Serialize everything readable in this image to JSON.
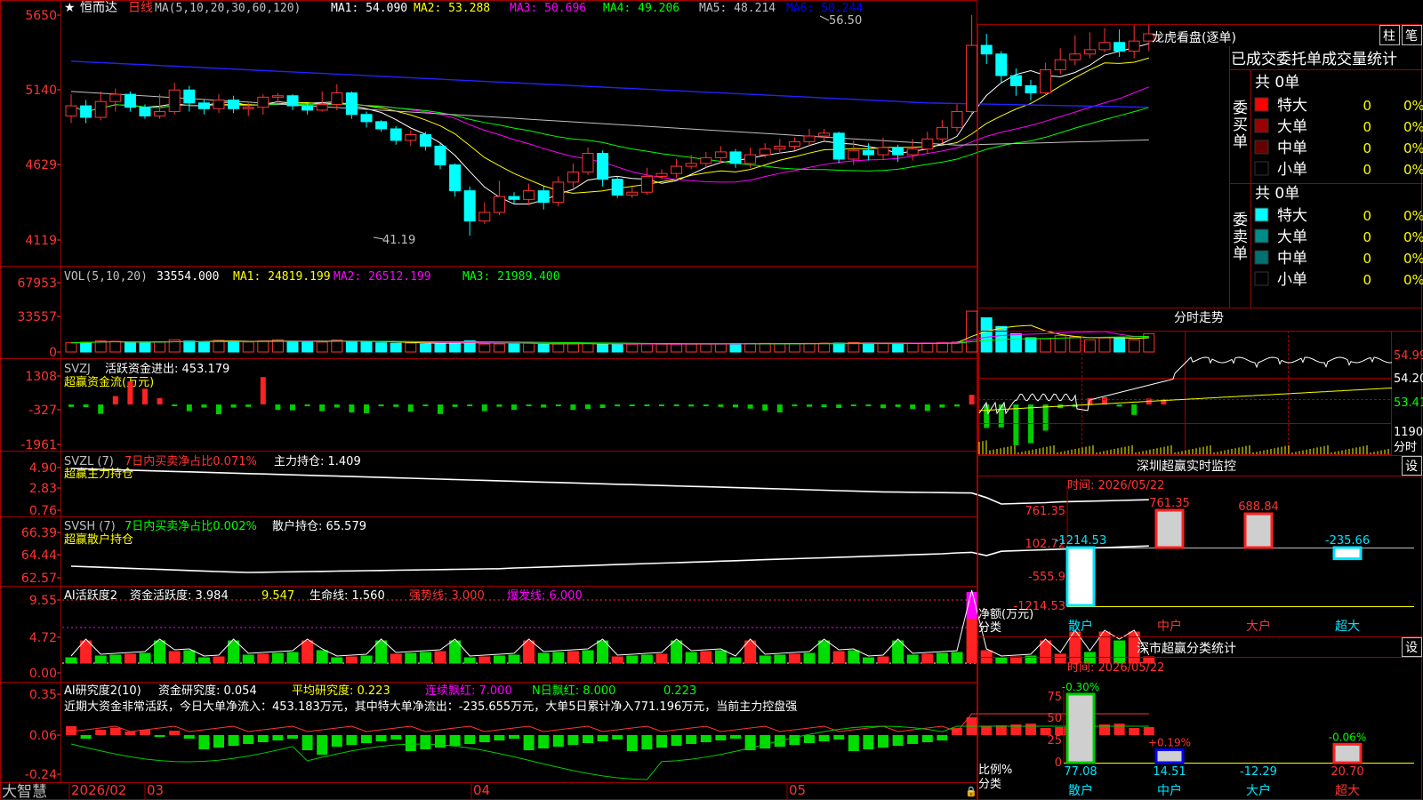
{
  "header": {
    "stock_name": "恒而达",
    "period": "日线",
    "ma_label": "MA(5,10,20,30,60,120)",
    "ma_values": [
      {
        "text": "MA1: 54.090",
        "color": "#ffffff"
      },
      {
        "text": "MA2: 53.288",
        "color": "#ffff00"
      },
      {
        "text": "MA3: 50.696",
        "color": "#ff00ff"
      },
      {
        "text": "MA4: 49.206",
        "color": "#00ff00"
      },
      {
        "text": "MA5: 48.214",
        "color": "#c0c0c0"
      },
      {
        "text": "MA6: 50.244",
        "color": "#0000ff"
      }
    ],
    "price_ticks": [
      "5650",
      "5140",
      "4629",
      "4119"
    ],
    "high_mark": "56.50",
    "low_mark": "41.19"
  },
  "volume": {
    "title": "VOL(5,10,20)",
    "value": "33554.000",
    "ma": [
      {
        "text": "MA1: 24819.199",
        "color": "#ffff00"
      },
      {
        "text": "MA2: 26512.199",
        "color": "#ff00ff"
      },
      {
        "text": "MA3: 21989.400",
        "color": "#00ff00"
      }
    ],
    "ticks": [
      "67953",
      "33557",
      "0"
    ]
  },
  "svzj": {
    "title": "SVZJ",
    "metric": "活跃资金进出: 453.179",
    "subtitle": "超赢资金流(万元)",
    "ticks": [
      "1308",
      "-327",
      "-1961"
    ]
  },
  "svzl": {
    "title": "SVZL (7)",
    "metric1": "7日内买卖净占比0.071%",
    "metric2": "主力持仓: 1.409",
    "subtitle": "超赢主力持仓",
    "ticks": [
      "4.90",
      "2.83",
      "0.76"
    ]
  },
  "svsh": {
    "title": "SVSH (7)",
    "metric1": "7日内买卖净占比0.002%",
    "metric2": "散户持仓: 65.579",
    "subtitle": "超赢散户持仓",
    "ticks": [
      "66.39",
      "64.44",
      "62.57"
    ]
  },
  "ai1": {
    "title": "AI活跃度2",
    "metric1": "资金活跃度: 3.984",
    "metric2": "9.547",
    "metric3": "生命线: 1.560",
    "metric4": "强势线: 3.000",
    "metric5": "爆发线: 6.000",
    "ticks": [
      "9.55",
      "4.72",
      "0.00"
    ]
  },
  "ai2": {
    "title": "AI研究度2(10)",
    "metric1": "资金研究度: 0.054",
    "metric2": "平均研究度: 0.223",
    "metric3": "连续飘红: 7.000",
    "metric4": "N日飘红: 8.000",
    "metric5": "0.223",
    "description": "近期大资金非常活跃，今日大单净流入：453.183万元，其中特大单净流出：-235.655万元，大单5日累计净入771.196万元，当前主力控盘强",
    "ticks": [
      "0.35",
      "0.06",
      "-0.24"
    ]
  },
  "xaxis": {
    "brand": "大智慧",
    "labels": [
      "2026/02",
      "03",
      "04",
      "05"
    ]
  },
  "dragon": {
    "title": "龙虎看盘(逐单)",
    "tab1": "柱",
    "tab2": "笔",
    "subtitle": "已成交委托单成交量统计",
    "buy_label": "委买单",
    "sell_label": "委卖单",
    "buy_total": "共 0单",
    "sell_total": "共 0单",
    "buy_rows": [
      {
        "name": "特大",
        "count": "0",
        "pct": "0%",
        "color": "#ff0000"
      },
      {
        "name": "大单",
        "count": "0",
        "pct": "0%",
        "color": "#990000"
      },
      {
        "name": "中单",
        "count": "0",
        "pct": "0%",
        "color": "#660000"
      },
      {
        "name": "小单",
        "count": "0",
        "pct": "0%",
        "color": "#000000"
      }
    ],
    "sell_rows": [
      {
        "name": "特大",
        "count": "0",
        "pct": "0%",
        "color": "#00ffff"
      },
      {
        "name": "大单",
        "count": "0",
        "pct": "0%",
        "color": "#008b8b"
      },
      {
        "name": "中单",
        "count": "0",
        "pct": "0%",
        "color": "#007070"
      },
      {
        "name": "小单",
        "count": "0",
        "pct": "0%",
        "color": "#000000"
      }
    ]
  },
  "intraday": {
    "title": "分时走势",
    "ticks": [
      "54.99",
      "54.20",
      "53.41"
    ],
    "vol_tick": "1190",
    "vol_label": "分时"
  },
  "sz_monitor": {
    "title": "深圳超赢实时监控",
    "settings": "设",
    "time": "时间: 2026/05/22",
    "ticks": [
      "761.35",
      "102.72",
      "-555.9",
      "-1214.53"
    ],
    "ylabel1": "净额(万元)",
    "ylabel2": "分类",
    "categories": [
      "散户",
      "中户",
      "大户",
      "超大"
    ],
    "values": [
      -1214.53,
      761.35,
      688.84,
      -235.66
    ],
    "value_labels": [
      "-1214.53",
      "761.35",
      "688.84",
      "-235.66"
    ]
  },
  "sz_class": {
    "title": "深市超赢分类统计",
    "settings": "设",
    "time": "时间: 2026/05/22",
    "ticks": [
      "75",
      "50",
      "25",
      "0"
    ],
    "ylabel1": "比例%",
    "ylabel2": "分类",
    "categories": [
      "散户",
      "中户",
      "大户",
      "超大"
    ],
    "values": [
      77.08,
      14.51,
      -12.29,
      20.7
    ],
    "value_labels": [
      "77.08",
      "14.51",
      "-12.29",
      "20.70"
    ],
    "changes": [
      "-0.30%",
      "+0.19%",
      "",
      "-0.06%"
    ]
  },
  "chart_data": [
    {
      "type": "candlestick",
      "title": "恒而达 日线",
      "ylim": [
        41.19,
        56.5
      ],
      "x_labels": [
        "2026/02",
        "03",
        "04",
        "05"
      ],
      "candles": [
        [
          49.5,
          50.2,
          51.0,
          49.0
        ],
        [
          50.2,
          49.4,
          50.6,
          49.0
        ],
        [
          49.4,
          50.5,
          51.2,
          49.2
        ],
        [
          50.5,
          51.0,
          51.4,
          49.8
        ],
        [
          51.0,
          50.1,
          51.2,
          49.8
        ],
        [
          50.1,
          49.5,
          50.3,
          49.3
        ],
        [
          49.5,
          49.8,
          51.0,
          49.3
        ],
        [
          49.8,
          51.3,
          51.8,
          49.6
        ],
        [
          51.3,
          50.4,
          51.6,
          49.8
        ],
        [
          50.4,
          50.0,
          50.6,
          49.6
        ],
        [
          50.0,
          50.6,
          51.0,
          49.7
        ],
        [
          50.6,
          50.0,
          50.9,
          49.7
        ],
        [
          50.0,
          50.1,
          50.4,
          49.5
        ],
        [
          50.1,
          50.8,
          51.0,
          49.6
        ],
        [
          50.8,
          50.9,
          51.1,
          50.4
        ],
        [
          50.9,
          50.2,
          51.0,
          49.9
        ],
        [
          50.2,
          49.9,
          50.4,
          49.6
        ],
        [
          49.9,
          50.3,
          51.2,
          49.8
        ],
        [
          50.3,
          51.1,
          51.7,
          49.9
        ],
        [
          51.1,
          49.6,
          51.2,
          49.3
        ],
        [
          49.6,
          49.1,
          49.8,
          48.7
        ],
        [
          49.1,
          48.6,
          49.2,
          48.4
        ],
        [
          48.6,
          47.8,
          48.8,
          47.5
        ],
        [
          47.8,
          48.2,
          48.5,
          47.4
        ],
        [
          48.2,
          47.4,
          48.4,
          47.1
        ],
        [
          47.4,
          46.1,
          47.6,
          45.8
        ],
        [
          46.1,
          44.3,
          46.2,
          43.9
        ],
        [
          44.3,
          42.2,
          44.6,
          41.19
        ],
        [
          42.2,
          42.8,
          43.5,
          42.0
        ],
        [
          42.8,
          43.9,
          45.0,
          42.6
        ],
        [
          43.9,
          43.7,
          44.2,
          43.4
        ],
        [
          43.7,
          44.3,
          44.8,
          43.3
        ],
        [
          44.3,
          43.5,
          44.6,
          43.0
        ],
        [
          43.5,
          44.9,
          45.3,
          43.2
        ],
        [
          44.9,
          45.6,
          46.2,
          44.5
        ],
        [
          45.6,
          46.9,
          47.3,
          45.4
        ],
        [
          46.9,
          45.1,
          47.1,
          44.6
        ],
        [
          45.1,
          44.0,
          45.3,
          43.8
        ],
        [
          44.0,
          44.2,
          44.6,
          43.8
        ],
        [
          44.2,
          45.3,
          45.9,
          44.0
        ],
        [
          45.3,
          45.5,
          45.8,
          45.1
        ],
        [
          45.5,
          46.0,
          46.5,
          45.2
        ],
        [
          46.0,
          46.2,
          46.8,
          45.8
        ],
        [
          46.2,
          46.6,
          47.0,
          45.9
        ],
        [
          46.6,
          47.0,
          47.4,
          46.2
        ],
        [
          47.0,
          46.2,
          47.2,
          45.9
        ],
        [
          46.2,
          46.8,
          47.3,
          45.9
        ],
        [
          46.8,
          47.2,
          47.6,
          46.6
        ],
        [
          47.2,
          47.4,
          47.9,
          46.9
        ],
        [
          47.4,
          47.7,
          48.0,
          47.1
        ],
        [
          47.7,
          48.1,
          48.6,
          47.4
        ],
        [
          48.1,
          48.3,
          48.6,
          47.8
        ],
        [
          48.3,
          46.5,
          48.4,
          46.2
        ],
        [
          46.5,
          47.1,
          47.8,
          46.1
        ],
        [
          47.1,
          46.8,
          47.6,
          46.4
        ],
        [
          46.8,
          47.3,
          48.0,
          46.5
        ],
        [
          47.3,
          46.8,
          47.5,
          46.3
        ],
        [
          46.8,
          47.2,
          47.9,
          46.4
        ],
        [
          47.2,
          47.9,
          48.4,
          46.9
        ],
        [
          47.9,
          48.7,
          49.2,
          47.6
        ],
        [
          48.7,
          49.8,
          50.3,
          48.4
        ],
        [
          49.8,
          54.4,
          56.5,
          49.6
        ],
        [
          54.4,
          53.8,
          55.2,
          53.1
        ],
        [
          53.8,
          52.3,
          54.0,
          51.8
        ],
        [
          52.3,
          51.6,
          52.8,
          50.9
        ],
        [
          51.6,
          51.1,
          52.0,
          50.6
        ],
        [
          51.1,
          52.7,
          53.2,
          50.9
        ],
        [
          52.7,
          53.4,
          54.2,
          52.4
        ],
        [
          53.4,
          53.8,
          55.1,
          53.0
        ],
        [
          53.8,
          54.1,
          55.3,
          53.5
        ],
        [
          54.1,
          54.6,
          55.6,
          53.9
        ],
        [
          54.6,
          54.0,
          55.5,
          53.6
        ],
        [
          54.0,
          54.7,
          55.8,
          53.5
        ],
        [
          54.7,
          55.2,
          55.9,
          54.0
        ]
      ]
    },
    {
      "type": "bar",
      "title": "VOL(5,10,20)",
      "ylim": [
        0,
        67953
      ],
      "values": [
        9000,
        9500,
        11000,
        10500,
        9200,
        9000,
        9800,
        12000,
        10800,
        10000,
        11500,
        10500,
        9800,
        11000,
        12000,
        10800,
        10200,
        9700,
        11800,
        10500,
        9900,
        9000,
        8600,
        8800,
        7900,
        8400,
        9200,
        11000,
        7800,
        7900,
        8200,
        8500,
        7700,
        7900,
        8100,
        8400,
        7800,
        7900,
        7600,
        7800,
        7800,
        7600,
        7700,
        7800,
        7900,
        8200,
        8300,
        8400,
        8000,
        8300,
        8400,
        8600,
        8700,
        9200,
        8800,
        8300,
        8600,
        8700,
        8800,
        9300,
        9800,
        40000,
        33554,
        25000,
        18000,
        14000,
        13000,
        16000,
        15000,
        12000,
        14000,
        13500,
        12000,
        18000
      ]
    },
    {
      "type": "bar",
      "title": "超赢资金流(万元)",
      "ylim": [
        -1961,
        1308
      ],
      "values": [
        -120,
        -130,
        -450,
        400,
        1100,
        750,
        300,
        -60,
        -320,
        -150,
        -470,
        -150,
        -120,
        1308,
        -260,
        -280,
        -70,
        -320,
        -150,
        -380,
        -420,
        -70,
        -120,
        -350,
        -40,
        -460,
        -120,
        -50,
        -320,
        -110,
        -260,
        -20,
        -150,
        -60,
        -260,
        -210,
        -170,
        -90,
        -60,
        -40,
        -80,
        -50,
        -100,
        -70,
        -120,
        -140,
        -200,
        -290,
        -380,
        -90,
        -110,
        -130,
        -170,
        -70,
        -40,
        -180,
        -120,
        -210,
        -310,
        -150,
        -100,
        460,
        -1120,
        -1100,
        -1950,
        -1850,
        -1250,
        -180,
        -120,
        300,
        340,
        -100,
        -500,
        280,
        260
      ]
    }
  ]
}
